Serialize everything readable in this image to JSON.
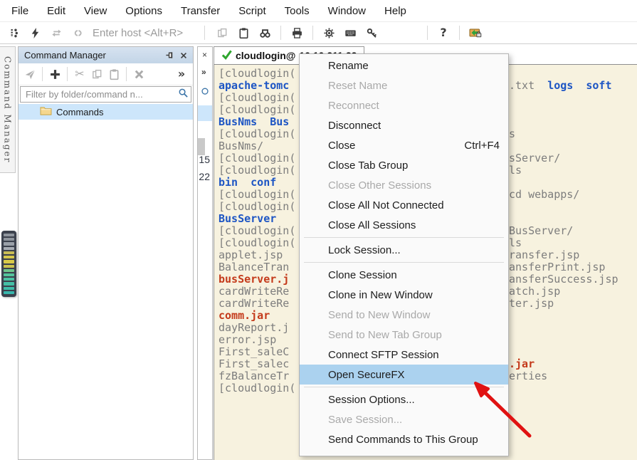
{
  "menubar": {
    "items": [
      "File",
      "Edit",
      "View",
      "Options",
      "Transfer",
      "Script",
      "Tools",
      "Window",
      "Help"
    ]
  },
  "toolbar": {
    "host_placeholder": "Enter host <Alt+R>",
    "left_icons": [
      {
        "name": "session-manager"
      },
      {
        "name": "quick-connect"
      },
      {
        "name": "reconnect",
        "disabled": true
      },
      {
        "name": "disconnect",
        "disabled": true
      }
    ],
    "right_groups": [
      [
        "copy",
        "paste",
        "find"
      ],
      [
        "print"
      ],
      [
        "settings",
        "keyboard",
        "key"
      ],
      [
        "help"
      ],
      [
        "securefx"
      ]
    ]
  },
  "side_tab": {
    "label": "Command Manager"
  },
  "side_meter": {
    "bar_colors": [
      "#8f959d",
      "#8f959d",
      "#9aa0a8",
      "#a8adb4",
      "#c9bd55",
      "#d6c84a",
      "#d9ca48",
      "#cbc24e",
      "#6ec48b",
      "#54c49c",
      "#4cc2a2",
      "#45bfa6",
      "#3fbda9",
      "#38b7ad"
    ]
  },
  "command_manager": {
    "title": "Command Manager",
    "toolbar_groups": [
      [
        "send-commands"
      ],
      [
        "add"
      ],
      [
        "cut",
        "copy",
        "paste-gray"
      ],
      [
        "delete"
      ]
    ],
    "overflow_icon": "chevrons",
    "filter_placeholder": "Filter by folder/command n...",
    "tree": [
      {
        "label": "Commands",
        "selected": true
      }
    ]
  },
  "hidden_panel": {
    "numbers": [
      "15",
      "22"
    ]
  },
  "session_tab": {
    "label": "cloudlogin@",
    "address": "10.10.211.22"
  },
  "context_menu": {
    "highlight_color": "#abd2ef",
    "items": [
      {
        "label": "Rename"
      },
      {
        "label": "Reset Name",
        "disabled": true
      },
      {
        "label": "Reconnect",
        "disabled": true
      },
      {
        "label": "Disconnect"
      },
      {
        "label": "Close",
        "shortcut": "Ctrl+F4"
      },
      {
        "label": "Close Tab Group"
      },
      {
        "label": "Close Other Sessions",
        "disabled": true
      },
      {
        "label": "Close All Not Connected"
      },
      {
        "label": "Close All Sessions"
      },
      {
        "separator": true
      },
      {
        "label": "Lock Session..."
      },
      {
        "separator": true
      },
      {
        "label": "Clone Session"
      },
      {
        "label": "Clone in New Window"
      },
      {
        "label": "Send to New Window",
        "disabled": true
      },
      {
        "label": "Send to New Tab Group",
        "disabled": true
      },
      {
        "label": "Connect SFTP Session"
      },
      {
        "label": "Open SecureFX",
        "highlighted": true
      },
      {
        "separator": true
      },
      {
        "label": "Session Options..."
      },
      {
        "label": "Save Session...",
        "disabled": true
      },
      {
        "label": "Send Commands to This Group"
      }
    ]
  },
  "terminal": {
    "colors": {
      "background": "#f7f2df",
      "gray": "#7d7d7d",
      "blue": "#1d55c4",
      "red": "#c43a1b"
    },
    "lines": [
      {
        "left": [
          {
            "t": "[cloudlogin(",
            "c": "gray"
          }
        ]
      },
      {
        "left": [
          {
            "t": "apache-tomc",
            "c": "blue"
          }
        ],
        "right": [
          {
            "t": ".txt  ",
            "c": "gray"
          },
          {
            "t": "logs  soft",
            "c": "blue"
          }
        ]
      },
      {
        "left": [
          {
            "t": "[cloudlogin(",
            "c": "gray"
          }
        ]
      },
      {
        "left": [
          {
            "t": "[cloudlogin(",
            "c": "gray"
          }
        ]
      },
      {
        "left": [
          {
            "t": "BusNms  Bus",
            "c": "blue"
          }
        ]
      },
      {
        "left": [
          {
            "t": "[cloudlogin(",
            "c": "gray"
          }
        ],
        "right": [
          {
            "t": "s",
            "c": "gray"
          }
        ]
      },
      {
        "left": [
          {
            "t": "BusNms/",
            "c": "gray"
          }
        ]
      },
      {
        "left": [
          {
            "t": "[cloudlogin(",
            "c": "gray"
          }
        ],
        "right": [
          {
            "t": "sServer/",
            "c": "gray"
          }
        ]
      },
      {
        "left": [
          {
            "t": "[cloudlogin(",
            "c": "gray"
          }
        ],
        "right": [
          {
            "t": "ls",
            "c": "gray"
          }
        ]
      },
      {
        "left": [
          {
            "t": "bin  conf",
            "c": "blue"
          }
        ]
      },
      {
        "left": [
          {
            "t": "[cloudlogin(",
            "c": "gray"
          }
        ],
        "right": [
          {
            "t": "cd webapps/",
            "c": "gray"
          }
        ]
      },
      {
        "left": [
          {
            "t": "[cloudlogin(",
            "c": "gray"
          }
        ]
      },
      {
        "left": [
          {
            "t": "BusServer",
            "c": "blue"
          }
        ]
      },
      {
        "left": [
          {
            "t": "[cloudlogin(",
            "c": "gray"
          }
        ],
        "right": [
          {
            "t": "BusServer/",
            "c": "gray"
          }
        ]
      },
      {
        "left": [
          {
            "t": "[cloudlogin(",
            "c": "gray"
          }
        ],
        "right": [
          {
            "t": "ls",
            "c": "gray"
          }
        ]
      },
      {
        "left": [
          {
            "t": "applet.jsp",
            "c": "gray"
          }
        ],
        "right": [
          {
            "t": "ransfer.jsp",
            "c": "gray"
          }
        ]
      },
      {
        "left": [
          {
            "t": "BalanceTran",
            "c": "gray"
          }
        ],
        "right": [
          {
            "t": "ansferPrint.jsp",
            "c": "gray"
          }
        ]
      },
      {
        "left": [
          {
            "t": "busServer.j",
            "c": "red"
          }
        ],
        "right": [
          {
            "t": "ansferSuccess.jsp",
            "c": "gray"
          }
        ]
      },
      {
        "left": [
          {
            "t": "cardWriteRe",
            "c": "gray"
          }
        ],
        "right": [
          {
            "t": "atch.jsp",
            "c": "gray"
          }
        ]
      },
      {
        "left": [
          {
            "t": "cardWriteRe",
            "c": "gray"
          }
        ],
        "right": [
          {
            "t": "ter.jsp",
            "c": "gray"
          }
        ]
      },
      {
        "left": [
          {
            "t": "comm.jar",
            "c": "red"
          }
        ]
      },
      {
        "left": [
          {
            "t": "dayReport.j",
            "c": "gray"
          }
        ]
      },
      {
        "left": [
          {
            "t": "error.jsp",
            "c": "gray"
          }
        ]
      },
      {
        "left": [
          {
            "t": "First_saleC",
            "c": "gray"
          }
        ]
      },
      {
        "left": [
          {
            "t": "First_salec",
            "c": "gray"
          }
        ],
        "right": [
          {
            "t": ".jar",
            "c": "red"
          }
        ]
      },
      {
        "left": [
          {
            "t": "fzBalanceTr",
            "c": "gray"
          }
        ],
        "right": [
          {
            "t": "erties",
            "c": "gray"
          }
        ]
      },
      {
        "left": [
          {
            "t": "[cloudlogin(",
            "c": "gray"
          }
        ]
      }
    ]
  },
  "annotation": {
    "arrow_color": "#e01212"
  }
}
